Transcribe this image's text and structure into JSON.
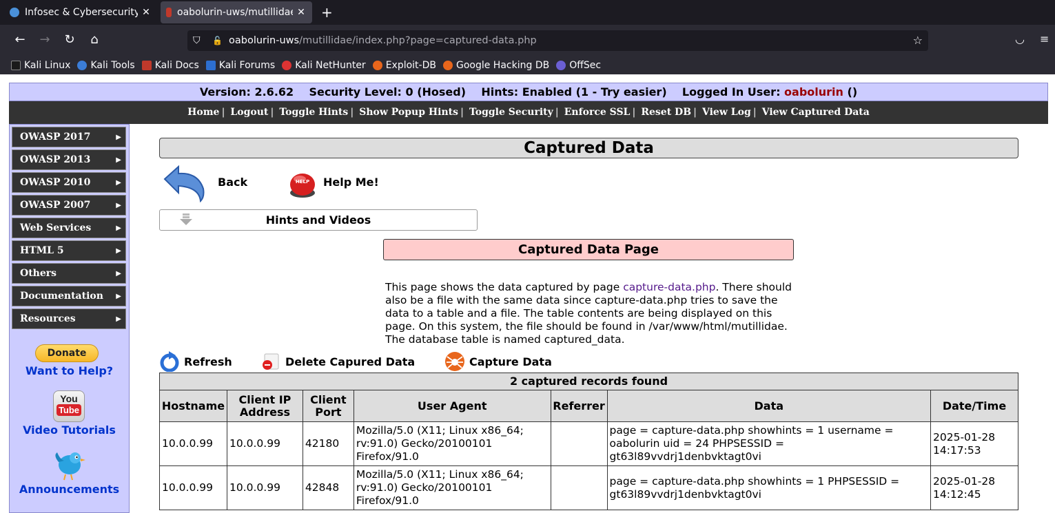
{
  "browser": {
    "tabs": [
      {
        "title": "Infosec & Cybersecurity Tr",
        "favicon_color": "#4a90d9"
      },
      {
        "title": "oabolurin-uws/mutillidae/",
        "favicon_color": "#c0392b"
      }
    ],
    "new_tab_label": "+",
    "url_host": "oabolurin-uws",
    "url_path": "/mutillidae/index.php?page=captured-data.php",
    "bookmarks": [
      {
        "label": "Kali Linux",
        "icon": "kali-dragon-icon"
      },
      {
        "label": "Kali Tools",
        "icon": "kali-tools-icon"
      },
      {
        "label": "Kali Docs",
        "icon": "kali-docs-icon"
      },
      {
        "label": "Kali Forums",
        "icon": "kali-forums-icon"
      },
      {
        "label": "Kali NetHunter",
        "icon": "nethunter-icon"
      },
      {
        "label": "Exploit-DB",
        "icon": "exploit-db-icon"
      },
      {
        "label": "Google Hacking DB",
        "icon": "ghdb-icon"
      },
      {
        "label": "OffSec",
        "icon": "offsec-icon"
      }
    ]
  },
  "info": {
    "version_label": "Version: 2.6.62",
    "security_label": "Security Level: 0 (Hosed)",
    "hints_label": "Hints: Enabled (1 - Try easier)",
    "user_prefix": "Logged In User:",
    "user_name": "oabolurin",
    "user_suffix": "()"
  },
  "menu": [
    "Home",
    "Logout",
    "Toggle Hints",
    "Show Popup Hints",
    "Toggle Security",
    "Enforce SSL",
    "Reset DB",
    "View Log",
    "View Captured Data"
  ],
  "sidebar": {
    "items": [
      "OWASP 2017",
      "OWASP 2013",
      "OWASP 2010",
      "OWASP 2007",
      "Web Services",
      "HTML 5",
      "Others",
      "Documentation",
      "Resources"
    ],
    "donate_label": "Donate",
    "want_help": "Want to Help?",
    "yt_you": "You",
    "yt_tube": "Tube",
    "video_tutorials": "Video Tutorials",
    "announcements": "Announcements"
  },
  "main": {
    "title": "Captured Data",
    "back_label": "Back",
    "help_label": "Help Me!",
    "hints_label": "Hints and Videos",
    "page_heading": "Captured Data Page",
    "desc_pre": "This page shows the data captured by page ",
    "desc_link": "capture-data.php",
    "desc_post": ". There should also be a file with the same data since capture-data.php tries to save the data to a table and a file. The table contents are being displayed on this page. On this system, the file should be found in /var/www/html/mutillidae. The database table is named captured_data.",
    "refresh_label": "Refresh",
    "delete_label": "Delete Capured Data",
    "capture_label": "Capture Data",
    "records_found": "2 captured records found",
    "columns": [
      "Hostname",
      "Client IP Address",
      "Client Port",
      "User Agent",
      "Referrer",
      "Data",
      "Date/Time"
    ],
    "rows": [
      [
        "10.0.0.99",
        "10.0.0.99",
        "42180",
        "Mozilla/5.0 (X11; Linux x86_64; rv:91.0) Gecko/20100101 Firefox/91.0",
        "",
        "page = capture-data.php showhints = 1 username = oabolurin uid = 24 PHPSESSID = gt63l89vvdrj1denbvktagt0vi",
        "2025-01-28 14:17:53"
      ],
      [
        "10.0.0.99",
        "10.0.0.99",
        "42848",
        "Mozilla/5.0 (X11; Linux x86_64; rv:91.0) Gecko/20100101 Firefox/91.0",
        "",
        "page = capture-data.php showhints = 1 PHPSESSID = gt63l89vvdrj1denbvktagt0vi",
        "2025-01-28 14:12:45"
      ]
    ]
  }
}
